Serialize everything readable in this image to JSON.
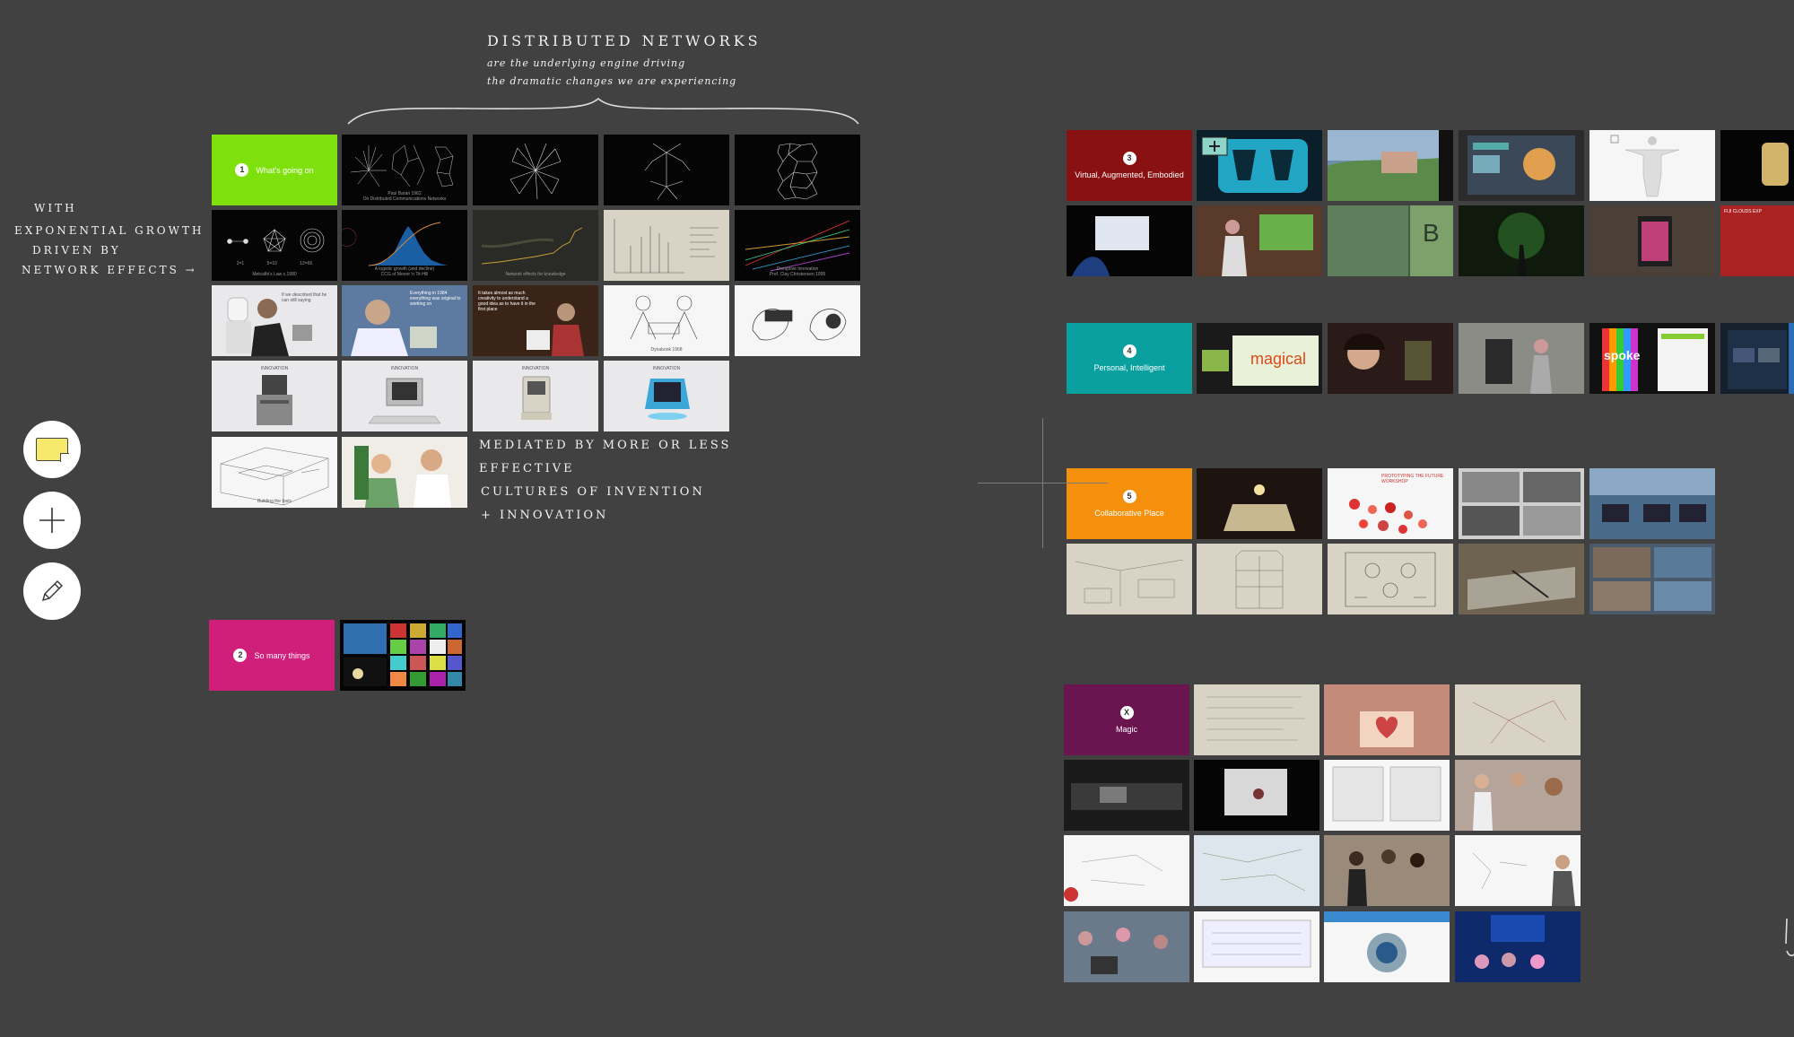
{
  "annotations": {
    "distributed_title": "DISTRIBUTED NETWORKS",
    "distributed_line1": "are the underlying engine driving",
    "distributed_line2": "the dramatic changes we are experiencing",
    "growth_line1": "WITH",
    "growth_line2": "EXPONENTIAL GROWTH",
    "growth_line3": "DRIVEN BY",
    "growth_line4": "NETWORK EFFECTS →",
    "mediated_line1": "MEDIATED BY MORE OR LESS",
    "mediated_line2": "EFFECTIVE",
    "mediated_line3": "CULTURES OF INVENTION",
    "mediated_line4": "+ INNOVATION"
  },
  "sections": {
    "s1": {
      "number": "1",
      "label": "What's going on",
      "color": "#7ee10e"
    },
    "s2": {
      "number": "2",
      "label": "So many things",
      "color": "#d01f7b"
    },
    "s3": {
      "number": "3",
      "label": "Virtual, Augmented, Embodied",
      "color": "#8a1111"
    },
    "s4": {
      "number": "4",
      "label": "Personal, Intelligent",
      "color": "#0aa0a0"
    },
    "s5": {
      "number": "5",
      "label": "Collaborative Place",
      "color": "#f4900c"
    },
    "sx": {
      "number": "X",
      "label": "Magic",
      "color": "#6b1550"
    }
  },
  "captions": {
    "baran": "Paul Baran 1962",
    "baran_sub": "On Distributed Communications Networks",
    "metcalfe": "Metcalfe's Law c.1980",
    "metcalfe_values": [
      "2=1",
      "5=10",
      "12=66"
    ],
    "growth": "A logistic growth (and decline)",
    "growth_sub": "CCG of Moore 'n Tit-Hill",
    "knowledge": "Network effects for knowledge",
    "disruptive": "Disruptive Innovation",
    "disruptive_sub": "Prof. Clay Christensen 1995",
    "quote1": "If we described that he can still saying",
    "quote2": "Everything in 1984 everything was original to working on",
    "quote3": "It takes almost as much creativity to understand a good idea as to have it in the first place",
    "sketch": "Dynabook 1968",
    "mac_label": "INNOVATION",
    "tool_caption": "Building the tools"
  },
  "thumbnail_text": {
    "magical": "magical",
    "spoke": "spoke",
    "future_workshop": "PROTOTYPING THE FUTURE WORKSHOP",
    "fiji": "FIJI CLOUDS EXP"
  },
  "tools": {
    "sticky": "sticky-note-tool",
    "add": "add-tool",
    "draw": "pencil-tool"
  }
}
